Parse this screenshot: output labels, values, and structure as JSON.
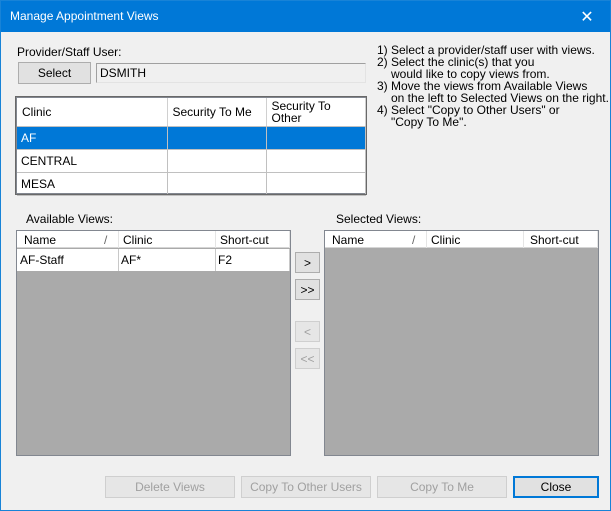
{
  "window": {
    "title": "Manage Appointment Views",
    "close_glyph": "✕"
  },
  "provider": {
    "label": "Provider/Staff User:",
    "select_button": "Select",
    "value": "DSMITH"
  },
  "instructions": [
    {
      "text": "1) Select a provider/staff user with views.",
      "indent": false
    },
    {
      "text": "2) Select the clinic(s) that you",
      "indent": false
    },
    {
      "text": "would like to copy views from.",
      "indent": true
    },
    {
      "text": "3) Move the views from Available Views",
      "indent": false
    },
    {
      "text": "on the left to Selected Views on the right.",
      "indent": true
    },
    {
      "text": "4) Select \"Copy to Other Users\" or",
      "indent": false
    },
    {
      "text": "\"Copy To Me\".",
      "indent": true
    }
  ],
  "clinic_grid": {
    "headers": [
      "Clinic",
      "Security To Me",
      "Security To Other"
    ],
    "rows": [
      {
        "clinic": "AF",
        "security_to_me": "",
        "security_to_other": "",
        "selected": true
      },
      {
        "clinic": "CENTRAL",
        "security_to_me": "",
        "security_to_other": "",
        "selected": false
      },
      {
        "clinic": "MESA",
        "security_to_me": "",
        "security_to_other": "",
        "selected": false
      }
    ]
  },
  "available_views": {
    "label": "Available Views:",
    "columns": [
      "Name",
      "Clinic",
      "Short-cut"
    ],
    "rows": [
      {
        "name": "AF-Staff",
        "clinic": "AF*",
        "shortcut": "F2"
      }
    ]
  },
  "selected_views": {
    "label": "Selected Views:",
    "columns": [
      "Name",
      "Clinic",
      "Short-cut"
    ],
    "rows": []
  },
  "move_buttons": {
    "move_one": ">",
    "move_all": ">>",
    "remove_one": "<",
    "remove_all": "<<"
  },
  "footer": {
    "delete_views": "Delete Views",
    "copy_to_other_users": "Copy To Other Users",
    "copy_to_me": "Copy To Me",
    "close": "Close"
  },
  "colors": {
    "title_bar": "#0078d7",
    "selection": "#0078d7",
    "list_background": "#aaaaaa"
  }
}
